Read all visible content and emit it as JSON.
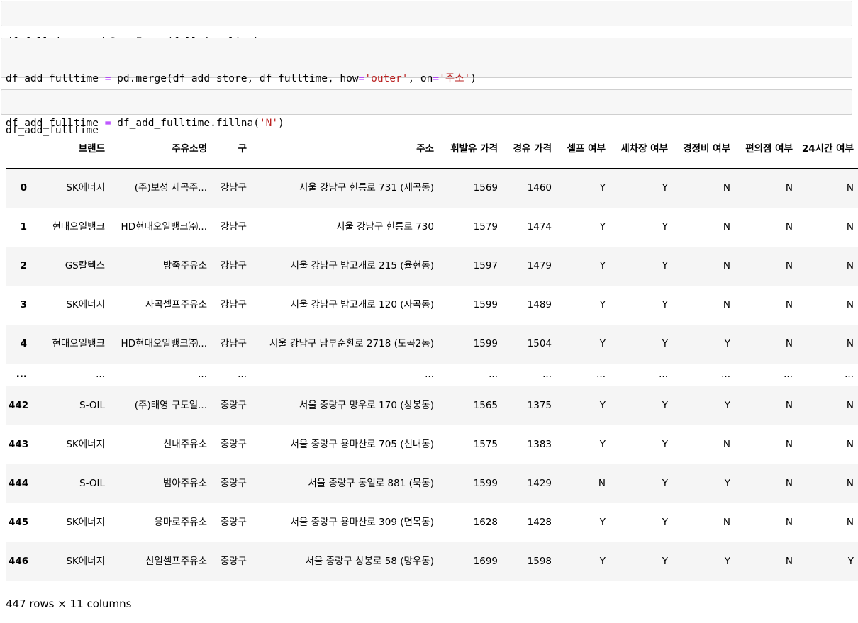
{
  "cells": [
    {
      "lines": [
        [
          {
            "t": "df_fulltime "
          },
          {
            "t": "=",
            "c": "op"
          },
          {
            "t": " pd.DataFrame(fulltime_list)"
          }
        ]
      ]
    },
    {
      "lines": [
        [
          {
            "t": "df_add_fulltime "
          },
          {
            "t": "=",
            "c": "op"
          },
          {
            "t": " pd.merge(df_add_store, df_fulltime, how"
          },
          {
            "t": "=",
            "c": "op"
          },
          {
            "t": "'outer'",
            "c": "str"
          },
          {
            "t": ", on"
          },
          {
            "t": "=",
            "c": "op"
          },
          {
            "t": "'주소'",
            "c": "str"
          },
          {
            "t": ")"
          }
        ],
        [
          {
            "t": "df_add_fulltime "
          },
          {
            "t": "=",
            "c": "op"
          },
          {
            "t": " df_add_fulltime.fillna("
          },
          {
            "t": "'N'",
            "c": "str"
          },
          {
            "t": ")"
          }
        ]
      ]
    },
    {
      "lines": [
        [
          {
            "t": "df_add_fulltime"
          }
        ]
      ]
    }
  ],
  "table": {
    "columns": [
      "",
      "브랜드",
      "주유소명",
      "구",
      "주소",
      "휘발유 가격",
      "경유 가격",
      "셀프 여부",
      "세차장 여부",
      "경정비 여부",
      "편의점 여부",
      "24시간 여부"
    ],
    "rows": [
      [
        "0",
        "SK에너지",
        "(주)보성 세곡주...",
        "강남구",
        "서울 강남구 헌릉로 731 (세곡동)",
        "1569",
        "1460",
        "Y",
        "Y",
        "N",
        "N",
        "N"
      ],
      [
        "1",
        "현대오일뱅크",
        "HD현대오일뱅크㈜...",
        "강남구",
        "서울 강남구 헌릉로 730",
        "1579",
        "1474",
        "Y",
        "Y",
        "N",
        "N",
        "N"
      ],
      [
        "2",
        "GS칼텍스",
        "방죽주유소",
        "강남구",
        "서울 강남구 밤고개로 215 (율현동)",
        "1597",
        "1479",
        "Y",
        "Y",
        "N",
        "N",
        "N"
      ],
      [
        "3",
        "SK에너지",
        "자곡셀프주유소",
        "강남구",
        "서울 강남구 밤고개로 120 (자곡동)",
        "1599",
        "1489",
        "Y",
        "Y",
        "N",
        "N",
        "N"
      ],
      [
        "4",
        "현대오일뱅크",
        "HD현대오일뱅크㈜...",
        "강남구",
        "서울 강남구 남부순환로 2718 (도곡2동)",
        "1599",
        "1504",
        "Y",
        "Y",
        "Y",
        "N",
        "N"
      ],
      [
        "...",
        "...",
        "...",
        "...",
        "...",
        "...",
        "...",
        "...",
        "...",
        "...",
        "...",
        "..."
      ],
      [
        "442",
        "S-OIL",
        "(주)태영 구도일...",
        "중랑구",
        "서울 중랑구 망우로 170 (상봉동)",
        "1565",
        "1375",
        "Y",
        "Y",
        "Y",
        "N",
        "N"
      ],
      [
        "443",
        "SK에너지",
        "신내주유소",
        "중랑구",
        "서울 중랑구 용마산로 705 (신내동)",
        "1575",
        "1383",
        "Y",
        "Y",
        "N",
        "N",
        "N"
      ],
      [
        "444",
        "S-OIL",
        "범아주유소",
        "중랑구",
        "서울 중랑구 동일로 881 (묵동)",
        "1599",
        "1429",
        "N",
        "Y",
        "Y",
        "N",
        "N"
      ],
      [
        "445",
        "SK에너지",
        "용마로주유소",
        "중랑구",
        "서울 중랑구 용마산로 309 (면목동)",
        "1628",
        "1428",
        "Y",
        "Y",
        "N",
        "N",
        "N"
      ],
      [
        "446",
        "SK에너지",
        "신일셀프주유소",
        "중랑구",
        "서울 중랑구 상봉로 58 (망우동)",
        "1699",
        "1598",
        "Y",
        "Y",
        "Y",
        "N",
        "Y"
      ]
    ]
  },
  "footer": "447 rows × 11 columns"
}
